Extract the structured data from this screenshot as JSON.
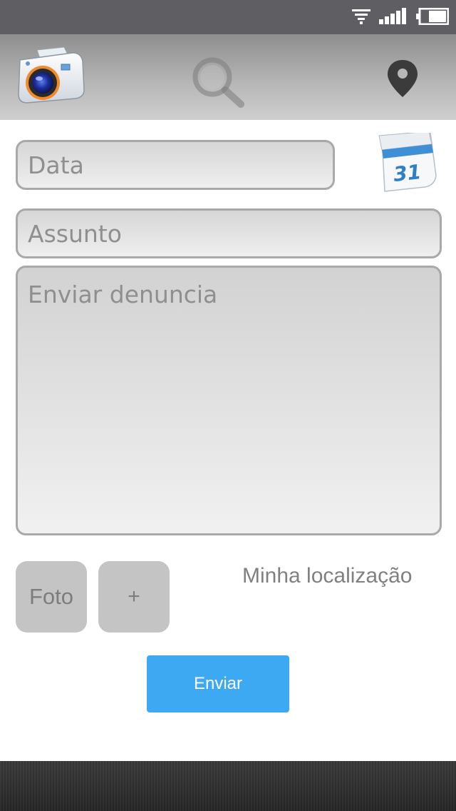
{
  "status_bar": {
    "wifi_icon": "wifi-icon",
    "signal_icon": "signal-icon",
    "battery_icon": "battery-icon"
  },
  "toolbar": {
    "camera_icon": "camera-icon",
    "search_icon": "search-icon",
    "location_icon": "location-pin-icon"
  },
  "form": {
    "date_placeholder": "Data",
    "calendar_icon_label": "31",
    "subject_placeholder": "Assunto",
    "report_placeholder": "Enviar denuncia",
    "photo_button": "Foto",
    "add_button": "+",
    "location_label": "Minha localização",
    "send_button": "Enviar"
  },
  "colors": {
    "send_button": "#3da9f2",
    "square_button": "#c4c4c4",
    "toolbar_top": "#8e8e8e",
    "status_bar": "#5f5f63"
  }
}
